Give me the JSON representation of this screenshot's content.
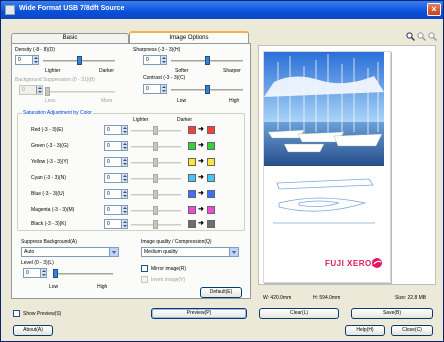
{
  "window": {
    "title": "Wide Format USB 7/8dft Source"
  },
  "tabs": [
    {
      "label": "Basic"
    },
    {
      "label": "Image Options"
    }
  ],
  "density": {
    "label": "Density (-8 - 8)(D)",
    "value": "0",
    "lighter": "Lighter",
    "darker": "Darker",
    "slider_level": 0.5
  },
  "background": {
    "label": "Background Suppression (0 - 31)(B)",
    "value": "0",
    "less": "Less",
    "more": "More",
    "slider_level": 0.0
  },
  "sharpness": {
    "label": "Sharpness (-3 - 3)(H)",
    "value": "0",
    "softer": "Softer",
    "sharper": "Sharper",
    "slider_level": 0.5
  },
  "contrast": {
    "label": "Contrast (-3 - 3)(C)",
    "value": "0",
    "low": "Low",
    "high": "High",
    "slider_level": 0.5
  },
  "color_adjust": {
    "title": "Saturation Adjustment by Color",
    "col_lighter": "Lighter",
    "col_darker": "Darker",
    "rows": [
      {
        "label": "Red (-3 - 3)(E)",
        "value": "0",
        "color": "#ff3b3b"
      },
      {
        "label": "Green (-3 - 3)(G)",
        "value": "0",
        "color": "#35d13d"
      },
      {
        "label": "Yellow (-3 - 3)(Y)",
        "value": "0",
        "color": "#ffe63a"
      },
      {
        "label": "Cyan (-3 - 3)(N)",
        "value": "0",
        "color": "#40c8ff"
      },
      {
        "label": "Blue (-3 - 3)(U)",
        "value": "0",
        "color": "#3e6dff"
      },
      {
        "label": "Magenta (-3 - 3)(M)",
        "value": "0",
        "color": "#f04ad8"
      },
      {
        "label": "Black (-3 - 3)(K)",
        "value": "0",
        "color": "#707070"
      }
    ]
  },
  "suppress_bg": {
    "label": "Suppress Background(A)",
    "value": "Auto"
  },
  "level": {
    "label": "Level (0 - 3)(L)",
    "value": "0",
    "low": "Low",
    "high": "High",
    "slider_level": 0.0
  },
  "image_quality": {
    "label": "Image quality / Compression(Q)",
    "value": "Medium quality"
  },
  "mirror": {
    "label": "Mirror image(R)"
  },
  "invert": {
    "label": "Invert image(V)"
  },
  "default_btn": "Default(E)",
  "preview": {
    "brand": "FUJI XEROX",
    "width": "W: 420.0mm",
    "height": "H: 594.0mm",
    "size": "Size: 22.8 MB"
  },
  "show_preview": {
    "label": "Show Preview(S)"
  },
  "buttons": {
    "preview": "Preview(P)",
    "clear": "Clear(L)",
    "save": "Save(B)",
    "about": "About(A)",
    "help": "Help(H)",
    "close": "Close(C)"
  },
  "colors": {
    "title_bar": "#0a4fd9",
    "brand_red": "#e0185e",
    "face": "#ece9d8"
  }
}
